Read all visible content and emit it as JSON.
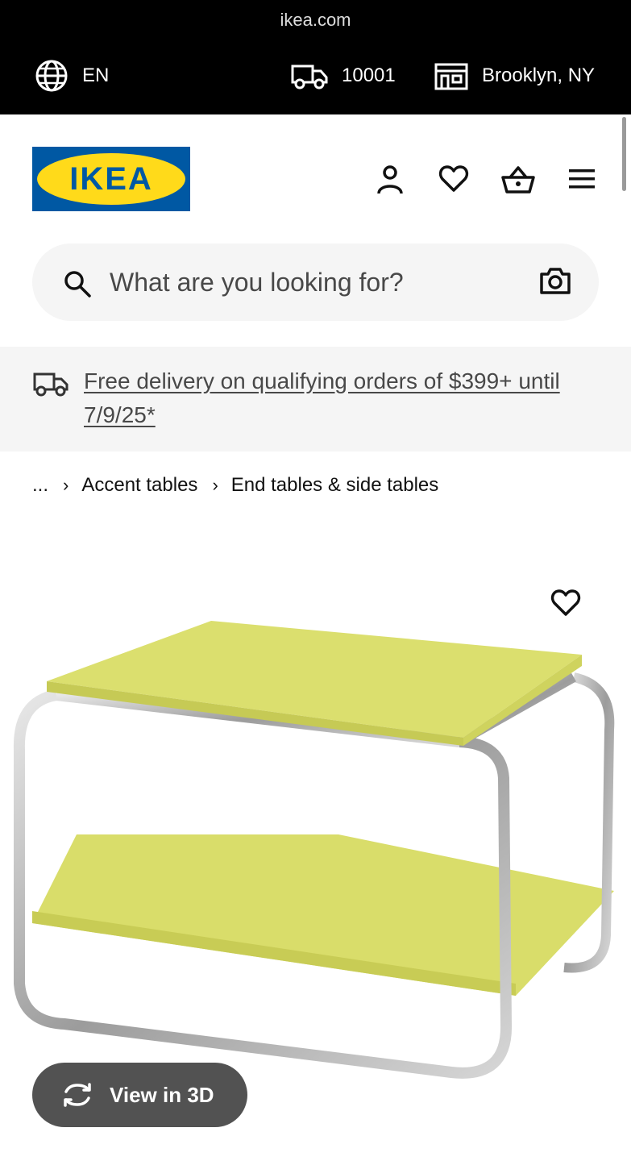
{
  "browser": {
    "url": "ikea.com"
  },
  "topbar": {
    "language": "EN",
    "zip": "10001",
    "store": "Brooklyn, NY"
  },
  "logo": {
    "text": "IKEA",
    "colors": {
      "blue": "#0058a3",
      "yellow": "#ffda1a"
    }
  },
  "header": {
    "icons": [
      "person-icon",
      "heart-icon",
      "basket-icon",
      "menu-icon"
    ]
  },
  "search": {
    "placeholder": "What are you looking for?"
  },
  "promo": {
    "text": "Free delivery on qualifying orders of $399+ until 7/9/25*"
  },
  "breadcrumb": {
    "items": [
      "...",
      "Accent tables",
      "End tables & side tables"
    ]
  },
  "product": {
    "image": "yellow-two-tier-side-table-chrome-frame",
    "view_3d_label": "View in 3D"
  }
}
